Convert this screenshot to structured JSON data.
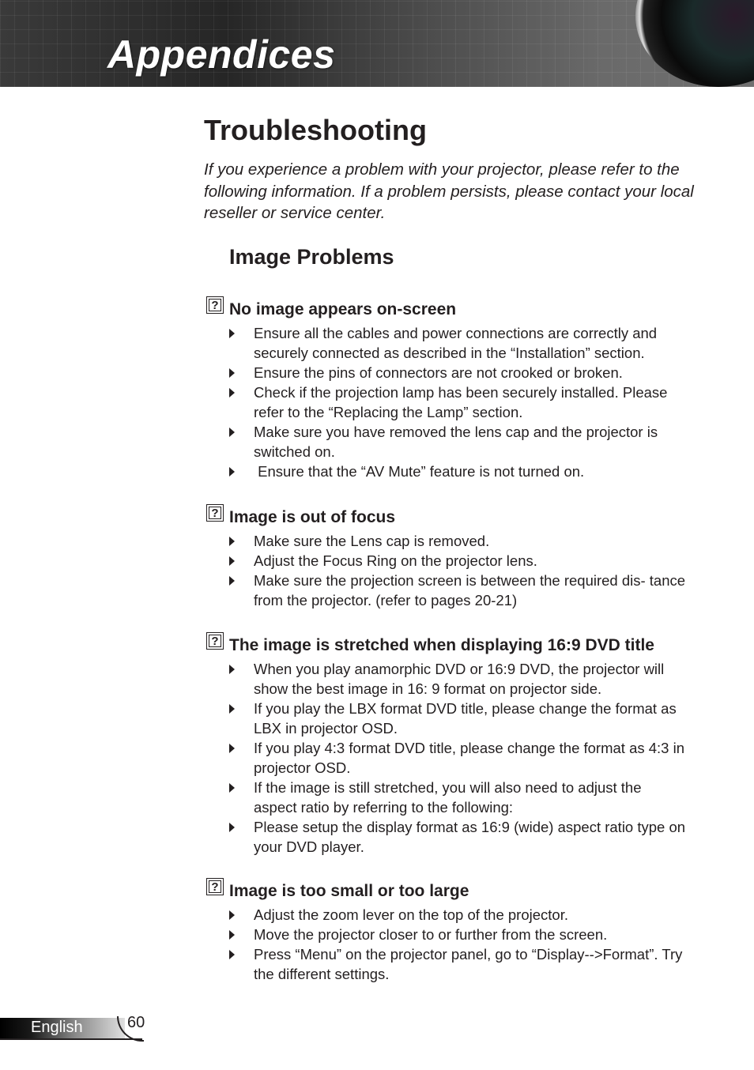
{
  "header": {
    "title": "Appendices"
  },
  "page_title": "Troubleshooting",
  "intro": "If you experience a problem with your projector, please refer to the following information. If a problem persists, please contact your local reseller or service center.",
  "section_heading": "Image Problems",
  "icon": {
    "question": "?"
  },
  "sections": [
    {
      "title": "No image appears on-screen",
      "items": [
        "Ensure all the cables and power connections are correctly and securely connected as described in the “Installation” section.",
        "Ensure the pins of connectors are not crooked or broken.",
        "Check if the projection lamp has been securely installed. Please refer to the “Replacing the Lamp” section.",
        "Make sure you have removed the lens cap and the projector is switched on.",
        " Ensure that the “AV Mute” feature is not turned on."
      ]
    },
    {
      "title": "Image is out of focus",
      "items": [
        "Make sure the Lens cap is removed.",
        "Adjust the Focus Ring on the projector lens.",
        "Make sure the projection screen is between the required dis- tance from the projector. (refer to pages 20-21)"
      ]
    },
    {
      "title": "The image is stretched when displaying 16:9 DVD title",
      "items": [
        "When you play anamorphic DVD or 16:9 DVD, the projector will show the best image in 16: 9 format on projector side.",
        "If you play the LBX format DVD title, please change the format as LBX in projector OSD.",
        "If you play 4:3 format DVD title, please change the format as 4:3 in projector OSD.",
        "If the image is still stretched, you will also need to adjust the aspect ratio by referring to the following:",
        "Please setup the display format as 16:9 (wide) aspect ratio type on your DVD player."
      ]
    },
    {
      "title": "Image is too small or too large",
      "items": [
        "Adjust the zoom lever on the top of the projector.",
        "Move the projector closer to or further from the screen.",
        "Press “Menu” on the projector panel, go to “Display-->Format”. Try the different settings."
      ]
    }
  ],
  "footer": {
    "language": "English",
    "page_number": "60"
  }
}
